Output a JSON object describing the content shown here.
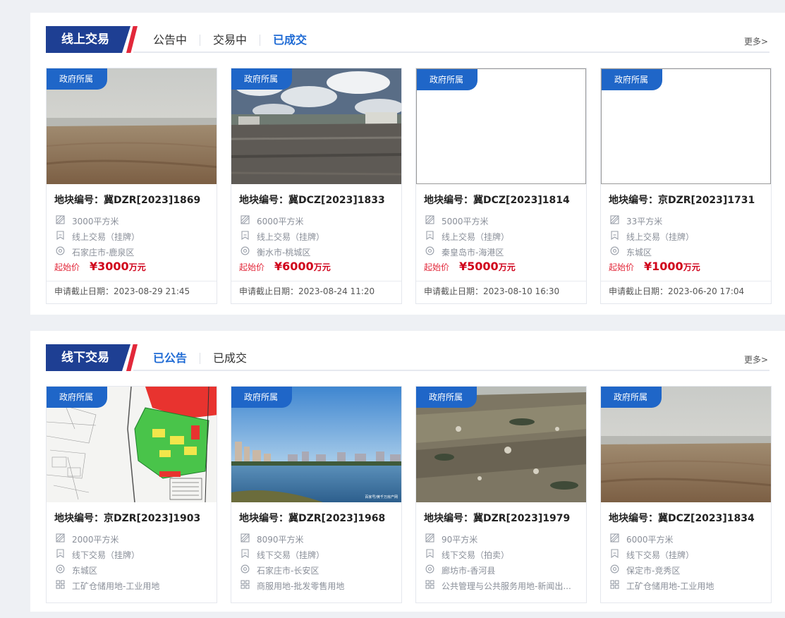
{
  "online": {
    "title": "线上交易",
    "tabs": [
      "公告中",
      "交易中",
      "已成交"
    ],
    "active_tab": 2,
    "more": "更多>",
    "cards": [
      {
        "badge": "政府所属",
        "title": "地块编号：冀DZR[2023]1869",
        "area": "3000平方米",
        "method": "线上交易（挂牌）",
        "location": "石家庄市-鹿泉区",
        "price_label": "起始价",
        "price": "¥3000",
        "price_unit": "万元",
        "deadline": "申请截止日期：2023-08-29 21:45",
        "image": "hazy-field"
      },
      {
        "badge": "政府所属",
        "title": "地块编号：冀DCZ[2023]1833",
        "area": "6000平方米",
        "method": "线上交易（挂牌）",
        "location": "衡水市-桃城区",
        "price_label": "起始价",
        "price": "¥6000",
        "price_unit": "万元",
        "deadline": "申请截止日期：2023-08-24 11:20",
        "image": "cloudy-field"
      },
      {
        "badge": "政府所属",
        "title": "地块编号：冀DCZ[2023]1814",
        "area": "5000平方米",
        "method": "线上交易（挂牌）",
        "location": "秦皇岛市-海港区",
        "price_label": "起始价",
        "price": "¥5000",
        "price_unit": "万元",
        "deadline": "申请截止日期：2023-08-10 16:30",
        "image": "blank"
      },
      {
        "badge": "政府所属",
        "title": "地块编号：京DZR[2023]1731",
        "area": "33平方米",
        "method": "线上交易（挂牌）",
        "location": "东城区",
        "price_label": "起始价",
        "price": "¥1000",
        "price_unit": "万元",
        "deadline": "申请截止日期：2023-06-20 17:04",
        "image": "blank"
      }
    ]
  },
  "offline": {
    "title": "线下交易",
    "tabs": [
      "已公告",
      "已成交"
    ],
    "active_tab": 0,
    "more": "更多>",
    "cards": [
      {
        "badge": "政府所属",
        "title": "地块编号：京DZR[2023]1903",
        "area": "2000平方米",
        "method": "线下交易（挂牌）",
        "location": "东城区",
        "usage": "工矿仓储用地-工业用地",
        "image": "site-plan"
      },
      {
        "badge": "政府所属",
        "title": "地块编号：冀DZR[2023]1968",
        "area": "8090平方米",
        "method": "线下交易（挂牌）",
        "location": "石家庄市-长安区",
        "usage": "商服用地-批发零售用地",
        "image": "lake-city",
        "watermark": "百家号/黄千万房产网"
      },
      {
        "badge": "政府所属",
        "title": "地块编号：冀DZR[2023]1979",
        "area": "90平方米",
        "method": "线下交易（拍卖）",
        "location": "廊坊市-香河县",
        "usage": "公共管理与公共服务用地-新闻出...",
        "image": "rubble"
      },
      {
        "badge": "政府所属",
        "title": "地块编号：冀DCZ[2023]1834",
        "area": "6000平方米",
        "method": "线下交易（挂牌）",
        "location": "保定市-竞秀区",
        "usage": "工矿仓储用地-工业用地",
        "image": "hazy-field"
      }
    ]
  }
}
